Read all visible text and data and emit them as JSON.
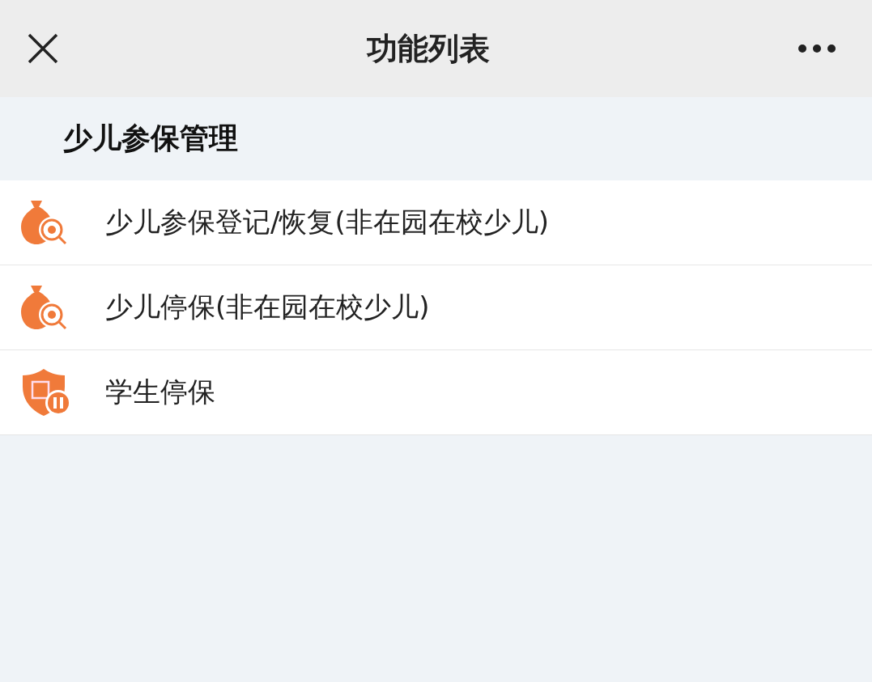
{
  "window": {
    "title": "功能列表"
  },
  "section": {
    "title": "少儿参保管理"
  },
  "items": [
    {
      "label": "少儿参保登记/恢复(非在园在校少儿)",
      "kind": "bag"
    },
    {
      "label": "少儿停保(非在园在校少儿)",
      "kind": "bag"
    },
    {
      "label": "学生停保",
      "kind": "shield"
    }
  ]
}
